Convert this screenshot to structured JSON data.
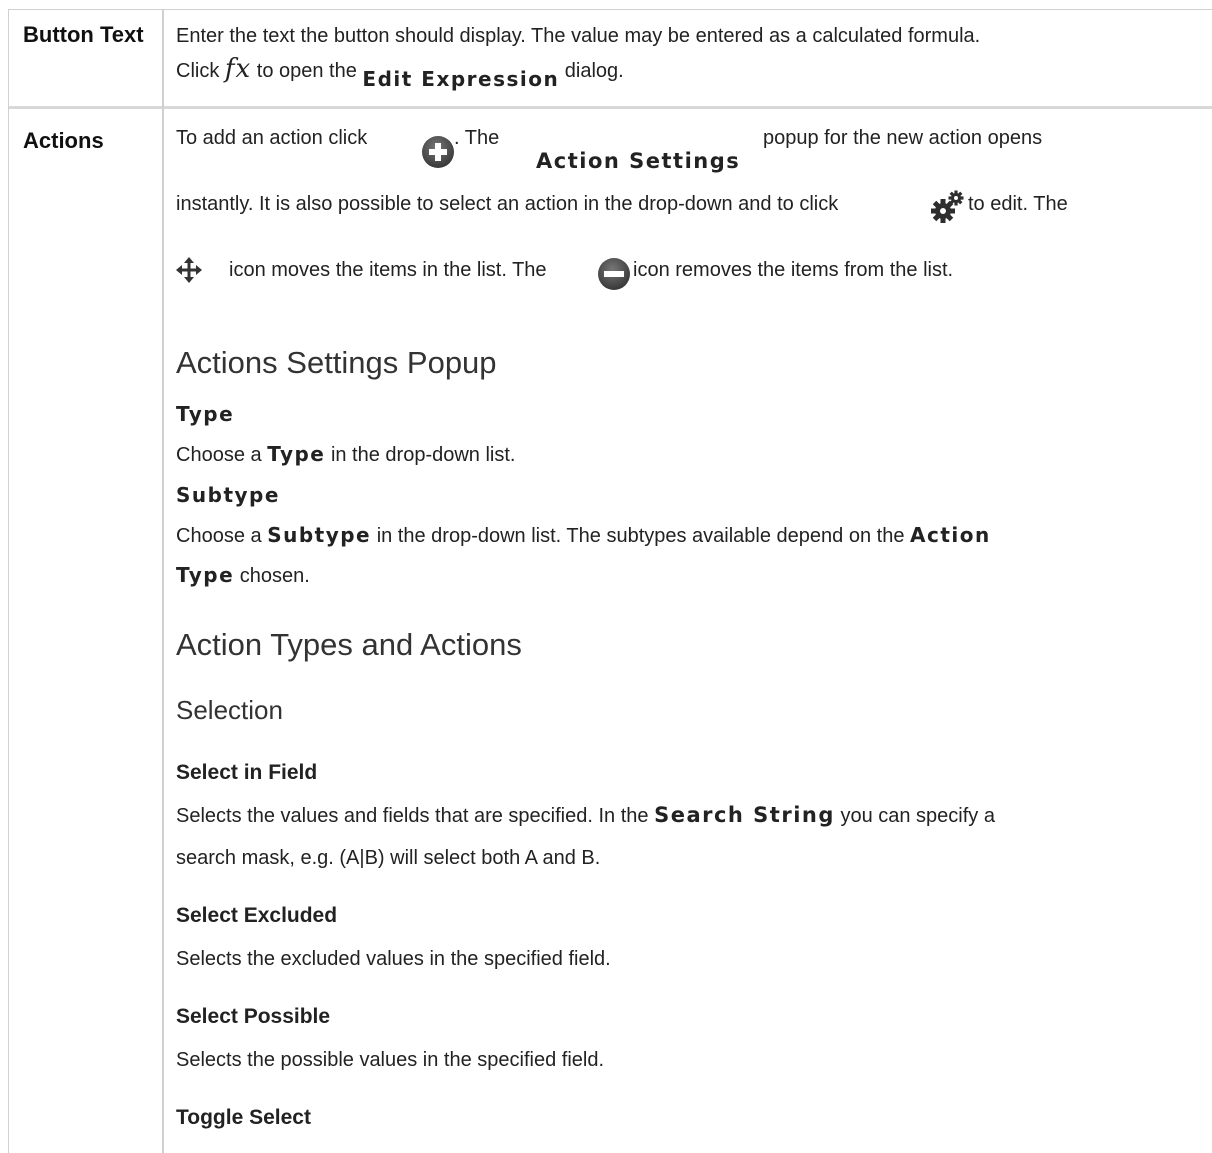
{
  "rows": [
    {
      "header": "Button Text",
      "line1": "Enter the text the button should display. The value may be entered as a calculated formula.",
      "line2_a": "Click",
      "fx_symbol": "fx",
      "line2_b": "to open the",
      "edit_expression": "Edit Expression",
      "line2_c": "dialog."
    },
    {
      "header": "Actions",
      "p1_a": "To add an action click",
      "p1_b": ". The",
      "action_settings": "Action Settings",
      "p1_c": "popup for the new action opens",
      "p2_a": "instantly. It is also possible to select an action in the drop-down and to click",
      "p2_b": "to edit. The",
      "p3_a": "icon moves the items in the list. The",
      "p3_b": "icon removes the items from the list."
    }
  ],
  "sections": {
    "popup_title": "Actions Settings Popup",
    "type_label": "Type",
    "type_a": "Choose a",
    "type_bold": "Type",
    "type_b": "in the drop-down list.",
    "subtype_label": "Subtype",
    "subtype_a": "Choose a",
    "subtype_bold": "Subtype",
    "subtype_b": "in the drop-down list. The subtypes available depend on the",
    "action_bold": "Action",
    "type_bold2": "Type",
    "chosen": "chosen.",
    "types_title": "Action Types and Actions",
    "selection_title": "Selection",
    "select_in_field": "Select in Field",
    "sif_a": "Selects the values and fields that are specified. In the",
    "search_string": "Search String",
    "sif_b": "you can specify a",
    "sif_c": "search mask, e.g. (A|B) will select both A and B.",
    "select_excluded": "Select Excluded",
    "se_desc": "Selects the excluded values in the specified field.",
    "select_possible": "Select Possible",
    "sp_desc": "Selects the possible values in the specified field.",
    "toggle_select": "Toggle Select"
  },
  "icons": {
    "add": "plus-circle-icon",
    "edit": "gears-icon",
    "move": "move-arrows-icon",
    "remove": "minus-circle-icon"
  }
}
